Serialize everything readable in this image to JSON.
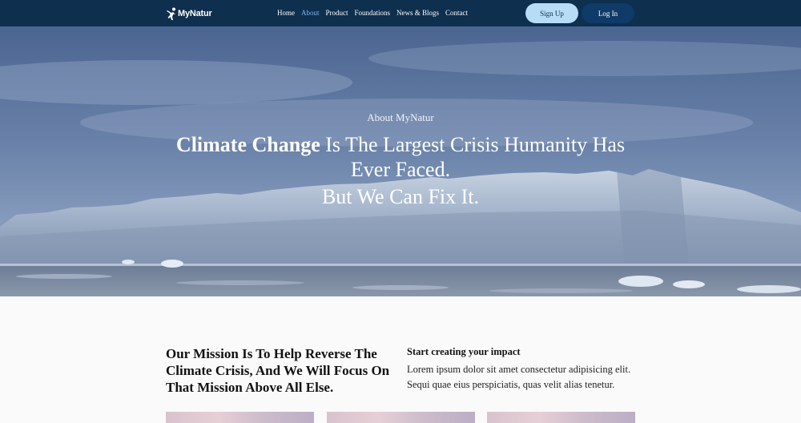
{
  "navbar": {
    "brand": "MyNatur",
    "links": [
      {
        "label": "Home",
        "active": false
      },
      {
        "label": "About",
        "active": true
      },
      {
        "label": "Product",
        "active": false
      },
      {
        "label": "Foundations",
        "active": false
      },
      {
        "label": "News & Blogs",
        "active": false
      },
      {
        "label": "Contact",
        "active": false
      }
    ],
    "signup_label": "Sign Up",
    "login_label": "Log In"
  },
  "hero": {
    "eyebrow": "About MyNatur",
    "title_bold": "Climate Change",
    "title_rest": " Is The Largest Crisis Humanity Has Ever Faced.",
    "subtitle": "But We Can Fix It."
  },
  "mission": {
    "heading": "Our Mission Is To Help Reverse The Climate Crisis, And We Will Focus On That Mission Above All Else."
  },
  "impact": {
    "title": "Start creating your impact",
    "text": "Lorem ipsum dolor sit amet consectetur adipisicing elit. Sequi quae eius perspiciatis, quas velit alias tenetur."
  },
  "colors": {
    "navbar_bg": "#0e2f4d",
    "nav_active": "#7fb6e8",
    "signup_bg": "#b6dcf6",
    "login_bg": "#0f3b68"
  }
}
